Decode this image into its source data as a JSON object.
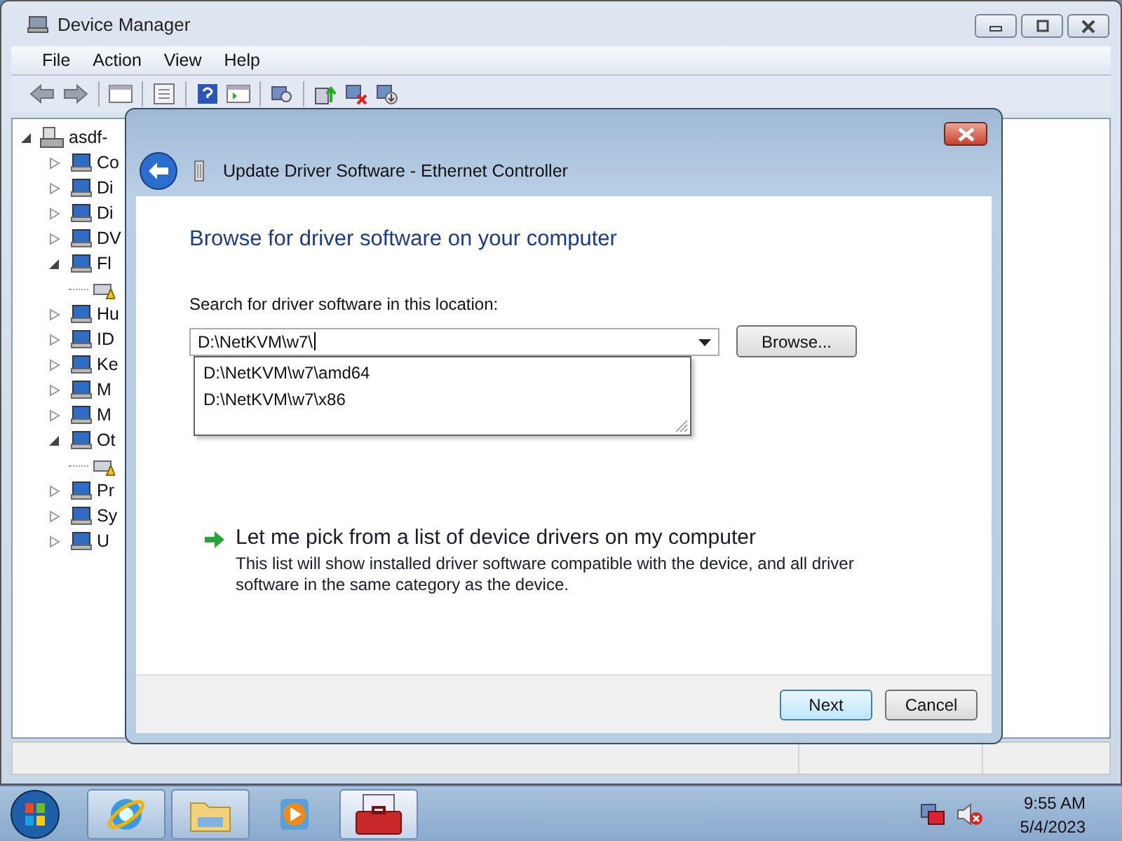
{
  "window": {
    "title": "Device Manager"
  },
  "menu": [
    "File",
    "Action",
    "View",
    "Help"
  ],
  "tree": {
    "label": "asdf-",
    "expanded": true,
    "children": [
      {
        "label": "Co",
        "expanded": false
      },
      {
        "label": "Di",
        "expanded": false
      },
      {
        "label": "Di",
        "expanded": false
      },
      {
        "label": "DV",
        "expanded": false
      },
      {
        "label": "Fl",
        "expanded": true,
        "children": [
          {
            "kind": "warning"
          }
        ]
      },
      {
        "label": "Hu",
        "expanded": false
      },
      {
        "label": "ID",
        "expanded": false
      },
      {
        "label": "Ke",
        "expanded": false
      },
      {
        "label": "M",
        "expanded": false
      },
      {
        "label": "M",
        "expanded": false
      },
      {
        "label": "Ot",
        "expanded": true,
        "children": [
          {
            "kind": "warning"
          }
        ]
      },
      {
        "label": "Pr",
        "expanded": false
      },
      {
        "label": "Sy",
        "expanded": false
      },
      {
        "label": "U",
        "expanded": false
      }
    ]
  },
  "dialog": {
    "title": "Update Driver Software - Ethernet Controller",
    "heading": "Browse for driver software on your computer",
    "location_label": "Search for driver software in this location:",
    "location": {
      "value": "D:\\NetKVM\\w7\\",
      "suggestions": [
        "D:\\NetKVM\\w7\\amd64",
        "D:\\NetKVM\\w7\\x86"
      ]
    },
    "browse_button": "Browse...",
    "pick_option": {
      "title": "Let me pick from a list of device drivers on my computer",
      "description": "This list will show installed driver software compatible with the device, and all driver software in the same category as the device."
    },
    "buttons": [
      {
        "label": "Next",
        "default": true
      },
      {
        "label": "Cancel",
        "default": false
      }
    ]
  },
  "taskbar": {
    "apps": [
      {
        "kind": "browser",
        "running": true
      },
      {
        "kind": "folder",
        "running": true
      },
      {
        "kind": "media",
        "running": false
      },
      {
        "kind": "toolbox",
        "running": true
      }
    ],
    "clock": {
      "time": "9:55 AM",
      "date": "5/4/2023"
    }
  }
}
